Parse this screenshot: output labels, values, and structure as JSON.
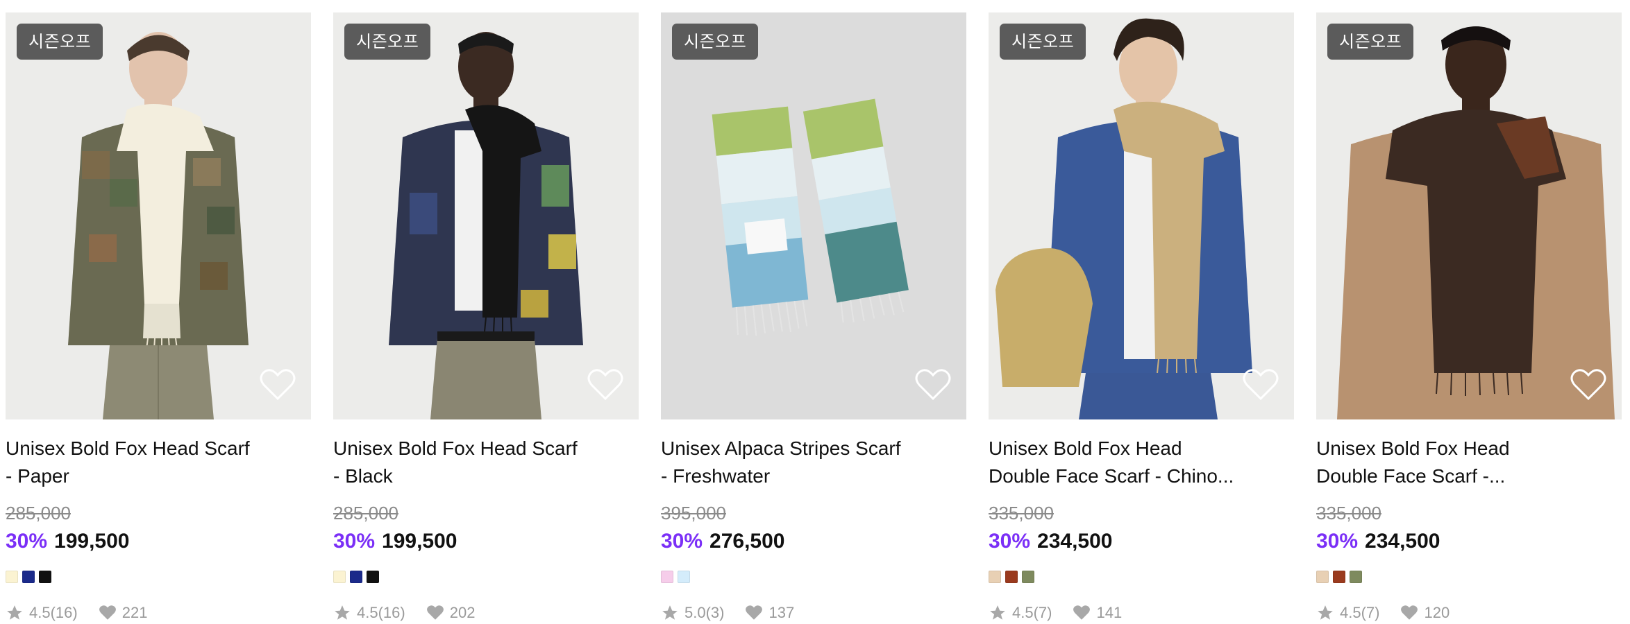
{
  "products": [
    {
      "badge": "시즌오프",
      "title_line1": "Unisex Bold Fox Head Scarf",
      "title_line2": "- Paper",
      "original_price": "285,000",
      "discount": "30%",
      "price": "199,500",
      "swatches": [
        "#fbf3d2",
        "#1b2a8a",
        "#111111"
      ],
      "rating": "4.5(16)",
      "likes": "221",
      "colors": {
        "bg": "#ececea",
        "scarf": "#f3eede",
        "body": "#6a6a52",
        "pants": "#8d8a74"
      }
    },
    {
      "badge": "시즌오프",
      "title_line1": "Unisex Bold Fox Head Scarf",
      "title_line2": "- Black",
      "original_price": "285,000",
      "discount": "30%",
      "price": "199,500",
      "swatches": [
        "#fbf3d2",
        "#1b2a8a",
        "#111111"
      ],
      "rating": "4.5(16)",
      "likes": "202",
      "colors": {
        "bg": "#ececea",
        "scarf": "#151515",
        "body": "#2f3650",
        "pants": "#8a8672"
      }
    },
    {
      "badge": "시즌오프",
      "title_line1": "Unisex Alpaca Stripes Scarf",
      "title_line2": "- Freshwater",
      "original_price": "395,000",
      "discount": "30%",
      "price": "276,500",
      "swatches": [
        "#f6cdea",
        "#d4ecfb"
      ],
      "rating": "5.0(3)",
      "likes": "137",
      "colors": {
        "bg": "#dcdcdc",
        "scarf": "#a9c46a",
        "body": "#7fb7d3",
        "pants": "#4d8a8a"
      }
    },
    {
      "badge": "시즌오프",
      "title_line1": "Unisex Bold Fox Head",
      "title_line2": "Double Face Scarf - Chino...",
      "original_price": "335,000",
      "discount": "30%",
      "price": "234,500",
      "swatches": [
        "#e8d0b4",
        "#9a3a1e",
        "#7e8a5e"
      ],
      "rating": "4.5(7)",
      "likes": "141",
      "colors": {
        "bg": "#ececea",
        "scarf": "#cbb07e",
        "body": "#3a5a9a",
        "pants": "#3a5896"
      }
    },
    {
      "badge": "시즌오프",
      "title_line1": "Unisex Bold Fox Head",
      "title_line2": "Double Face Scarf -...",
      "original_price": "335,000",
      "discount": "30%",
      "price": "234,500",
      "swatches": [
        "#e8d0b4",
        "#9a3a1e",
        "#7e8a5e"
      ],
      "rating": "4.5(7)",
      "likes": "120",
      "colors": {
        "bg": "#ececea",
        "scarf": "#3b2a22",
        "body": "#b89270",
        "pants": "#a07e5c"
      }
    }
  ],
  "icons": {
    "wishlist": "heart-outline-icon",
    "rating": "star-icon",
    "likes": "heart-filled-icon"
  }
}
